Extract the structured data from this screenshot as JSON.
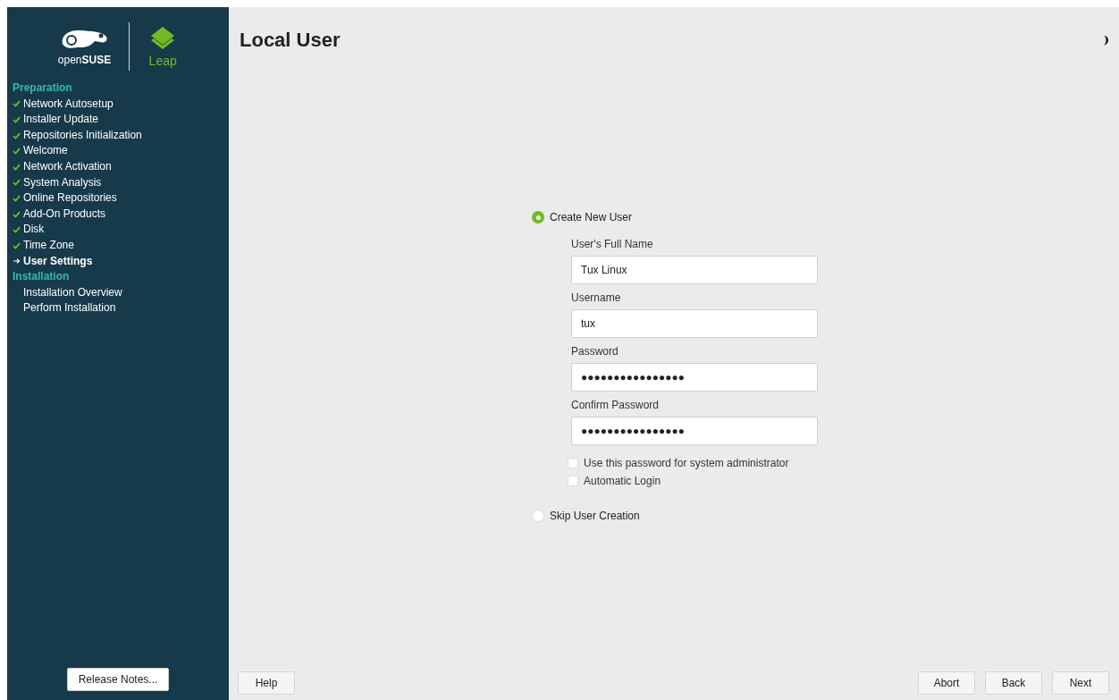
{
  "sidebar": {
    "logo": {
      "brand": "open**SUSE**",
      "product": "Leap"
    },
    "sections": [
      {
        "title": "Preparation",
        "steps": [
          {
            "label": "Network Autosetup",
            "done": true,
            "current": false
          },
          {
            "label": "Installer Update",
            "done": true,
            "current": false
          },
          {
            "label": "Repositories Initialization",
            "done": true,
            "current": false
          },
          {
            "label": "Welcome",
            "done": true,
            "current": false
          },
          {
            "label": "Network Activation",
            "done": true,
            "current": false
          },
          {
            "label": "System Analysis",
            "done": true,
            "current": false
          },
          {
            "label": "Online Repositories",
            "done": true,
            "current": false
          },
          {
            "label": "Add-On Products",
            "done": true,
            "current": false
          },
          {
            "label": "Disk",
            "done": true,
            "current": false
          },
          {
            "label": "Time Zone",
            "done": true,
            "current": false
          },
          {
            "label": "User Settings",
            "done": false,
            "current": true
          }
        ]
      },
      {
        "title": "Installation",
        "steps": [
          {
            "label": "Installation Overview",
            "done": false,
            "current": false
          },
          {
            "label": "Perform Installation",
            "done": false,
            "current": false
          }
        ]
      }
    ],
    "release_notes_button": "Release Notes..."
  },
  "title": "Local User",
  "create_user": {
    "label": "Create New User",
    "selected": true,
    "fields": [
      {
        "label": "User's Full Name",
        "value": "Tux Linux"
      },
      {
        "label": "Username",
        "value": "tux"
      },
      {
        "label": "Password",
        "value": "●●●●●●●●●●●●●●●●"
      },
      {
        "label": "Confirm Password",
        "value": "●●●●●●●●●●●●●●●●"
      }
    ],
    "checkboxes": [
      {
        "label": "Use this password for system administrator",
        "checked": false
      },
      {
        "label": "Automatic Login",
        "checked": false
      }
    ]
  },
  "skip_user": {
    "label": "Skip User Creation",
    "selected": false
  },
  "buttons": {
    "help": "Help",
    "abort": "Abort",
    "back": "Back",
    "next": "Next"
  }
}
